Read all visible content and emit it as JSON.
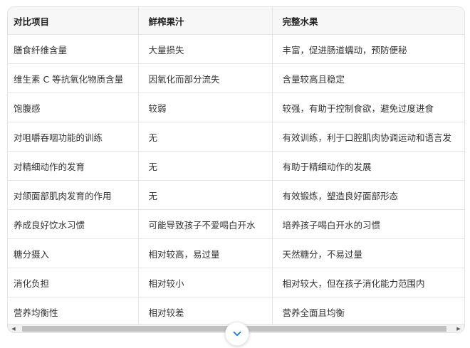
{
  "table": {
    "headers": [
      "对比项目",
      "鲜榨果汁",
      "完整水果"
    ],
    "rows": [
      [
        "膳食纤维含量",
        "大量损失",
        "丰富，促进肠道蠕动，预防便秘"
      ],
      [
        "维生素 C 等抗氧化物质含量",
        "因氧化而部分流失",
        "含量较高且稳定"
      ],
      [
        "饱腹感",
        "较弱",
        "较强，有助于控制食欲，避免过度进食"
      ],
      [
        "对咀嚼吞咽功能的训练",
        "无",
        "有效训练，利于口腔肌肉协调运动和语言发"
      ],
      [
        "对精细动作的发育",
        "无",
        "有助于精细动作的发展"
      ],
      [
        "对颌面部肌肉发育的作用",
        "无",
        "有效锻炼，塑造良好面部形态"
      ],
      [
        "养成良好饮水习惯",
        "可能导致孩子不爱喝白开水",
        "培养孩子喝白开水的习惯"
      ],
      [
        "糖分摄入",
        "相对较高，易过量",
        "天然糖分，不易过量"
      ],
      [
        "消化负担",
        "相对较小",
        "相对较大，但在孩子消化能力范围内"
      ],
      [
        "营养均衡性",
        "相对较差",
        "营养全面且均衡"
      ]
    ]
  },
  "scrollbar": {
    "left_arrow": "◀",
    "right_arrow": "▶"
  },
  "expand_button": {
    "icon": "chevron-down-icon",
    "color": "#1a73e8"
  }
}
